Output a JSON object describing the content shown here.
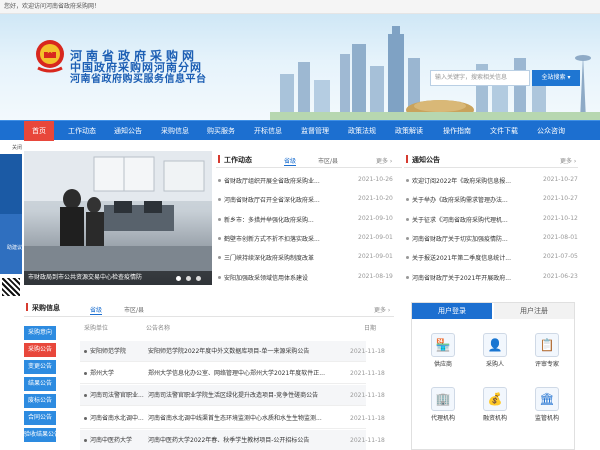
{
  "topbar": {
    "welcome": "您好，欢迎访问河南省政府采购网！"
  },
  "header": {
    "logo_lines": [
      "河南省政府采购网",
      "中国政府采购网河南分网",
      "河南省政府购买服务信息平台"
    ],
    "search_placeholder": "输入关键字，搜索相关信息",
    "search_select": "全站搜索 ▾"
  },
  "nav": {
    "items": [
      "首页",
      "工作动态",
      "通知公告",
      "采购信息",
      "购买服务",
      "开标信息",
      "监督管理",
      "政策法规",
      "政策解读",
      "操作指南",
      "文件下载",
      "公众咨询"
    ]
  },
  "side_float": {
    "texts": [
      "关闭",
      "助建议"
    ]
  },
  "slider": {
    "caption": "市财政局到市公共资源交易中心检查疫情防"
  },
  "work_news": {
    "title": "工作动态",
    "tabs": [
      "省级",
      "市区/县"
    ],
    "more": "更多 ›",
    "items": [
      {
        "text": "省财政厅组织开展全省政府采购业...",
        "date": "2021-10-26"
      },
      {
        "text": "河南省财政厅召开全省深化政府采...",
        "date": "2021-10-20"
      },
      {
        "text": "新乡市：多措并举强化政府采购...",
        "date": "2021-09-10"
      },
      {
        "text": "鹤壁市创新方式不折不扣落实政采...",
        "date": "2021-09-01"
      },
      {
        "text": "三门峡持续深化政府采购制度改革",
        "date": "2021-09-01"
      },
      {
        "text": "安阳加强政采领域信用体系建设",
        "date": "2021-08-19"
      }
    ]
  },
  "notices": {
    "title": "通知公告",
    "more": "更多 ›",
    "items": [
      {
        "text": "欢迎订阅2022年《政府采购信息报...",
        "date": "2021-10-27"
      },
      {
        "text": "关于举办《政府采购需求管理办法...",
        "date": "2021-10-27"
      },
      {
        "text": "关于征求《河南省政府采购代理机...",
        "date": "2021-10-12"
      },
      {
        "text": "河南省财政厅关于切实加强疫情防...",
        "date": "2021-08-01"
      },
      {
        "text": "关于报送2021年第二季度信息统计...",
        "date": "2021-07-05"
      },
      {
        "text": "河南省财政厅关于2021年开展政府...",
        "date": "2021-06-23"
      }
    ]
  },
  "procurement": {
    "title": "采购信息",
    "tabs": [
      "省级",
      "市区/县"
    ],
    "more": "更多 ›",
    "columns": [
      "采购单位",
      "公告名称",
      "日期"
    ],
    "side_menu": [
      "采购意向",
      "采购公告",
      "变更公告",
      "结果公告",
      "废标公告",
      "合同公告",
      "验收结果公告"
    ],
    "rows": [
      {
        "unit": "安阳师范学院",
        "name": "安阳师范学院2022年度中外文数据库项目-单一来源采购公告",
        "date": "2021-11-18"
      },
      {
        "unit": "郑州大学",
        "name": "郑州大学信息化办公室、网络管理中心郑州大学2021年度软件正...",
        "date": "2021-11-18"
      },
      {
        "unit": "河南司法警官职业...",
        "name": "河南司法警官职业学院生活区绿化提升改造项目-竞争性磋商公告",
        "date": "2021-11-18"
      },
      {
        "unit": "河南省南水北调中...",
        "name": "河南省南水北调中线渠首生态环境监测中心水质和水生生物监测...",
        "date": "2021-11-18"
      },
      {
        "unit": "河南中医药大学",
        "name": "河南中医药大学2022年春、秋季学生教材项目-公开招标公告",
        "date": "2021-11-18"
      }
    ]
  },
  "login": {
    "tabs": [
      "用户登录",
      "用户注册"
    ],
    "services": [
      {
        "label": "供应商",
        "icon": "supplier-icon"
      },
      {
        "label": "采购人",
        "icon": "purchaser-icon"
      },
      {
        "label": "评审专家",
        "icon": "expert-icon"
      },
      {
        "label": "代理机构",
        "icon": "agency-icon"
      },
      {
        "label": "融资机构",
        "icon": "finance-icon"
      },
      {
        "label": "监管机构",
        "icon": "regulator-icon"
      }
    ]
  },
  "colors": {
    "nav_blue": "#1c6fd0",
    "active_red": "#e8473b",
    "accent_red": "#d63b30"
  }
}
